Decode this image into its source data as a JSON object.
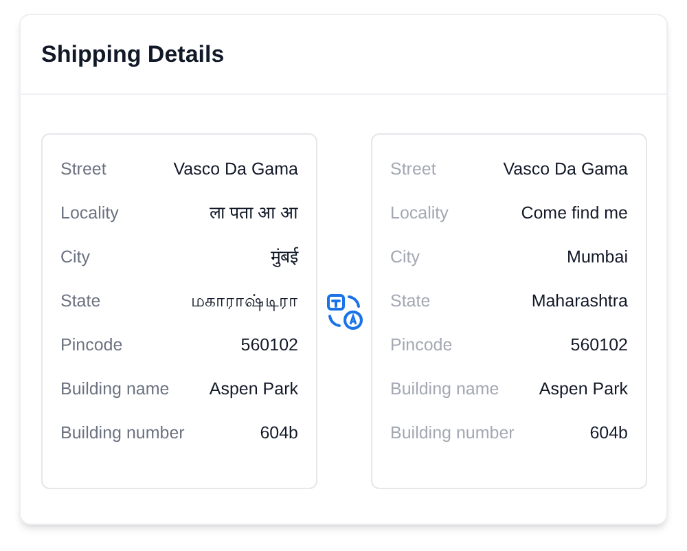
{
  "title": "Shipping Details",
  "cards": [
    {
      "muted_labels": false,
      "rows": [
        {
          "label": "Street",
          "value": "Vasco Da Gama"
        },
        {
          "label": "Locality",
          "value": "ला पता आ आ"
        },
        {
          "label": "City",
          "value": "मुंबई"
        },
        {
          "label": "State",
          "value": "மகாராஷ்டிரா"
        },
        {
          "label": "Pincode",
          "value": "560102"
        },
        {
          "label": "Building name",
          "value": "Aspen Park"
        },
        {
          "label": "Building number",
          "value": "604b"
        }
      ]
    },
    {
      "muted_labels": true,
      "rows": [
        {
          "label": "Street",
          "value": "Vasco Da Gama"
        },
        {
          "label": "Locality",
          "value": "Come find me"
        },
        {
          "label": "City",
          "value": "Mumbai"
        },
        {
          "label": "State",
          "value": "Maharashtra"
        },
        {
          "label": "Pincode",
          "value": "560102"
        },
        {
          "label": "Building name",
          "value": "Aspen Park"
        },
        {
          "label": "Building number",
          "value": "604b"
        }
      ]
    }
  ]
}
